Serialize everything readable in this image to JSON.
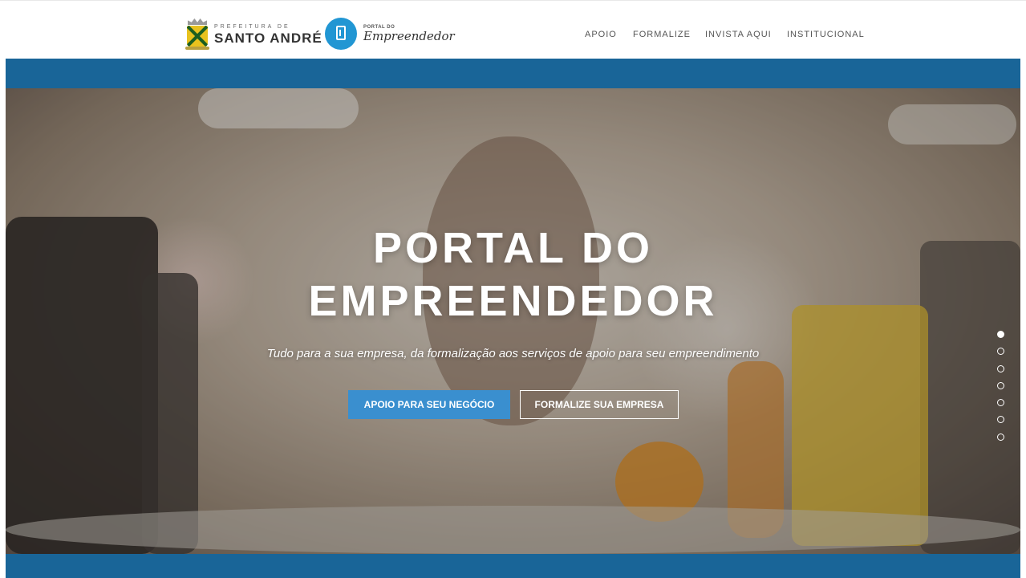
{
  "header": {
    "logo_prefeitura": {
      "small": "PREFEITURA DE",
      "big": "SANTO ANDRÉ"
    },
    "logo_portal": {
      "small": "PORTAL DO",
      "big": "Empreendedor"
    },
    "nav": [
      {
        "label": "APOIO"
      },
      {
        "label": "FORMALIZE"
      },
      {
        "label": "INVISTA AQUI"
      },
      {
        "label": "INSTITUCIONAL"
      }
    ]
  },
  "hero": {
    "title_line1": "PORTAL DO",
    "title_line2": "EMPREENDEDOR",
    "subtitle": "Tudo para a sua empresa, da formalização aos serviços de apoio para seu empreendimento",
    "primary_button": "APOIO PARA SEU NEGÓCIO",
    "secondary_button": "FORMALIZE SUA EMPRESA",
    "slider": {
      "slide_count": 7,
      "active_index": 0
    }
  },
  "colors": {
    "band": "#196598",
    "primary_button": "#3a8fcf",
    "logo_circle": "#2196d3",
    "nav_text": "#555555"
  },
  "icons": [
    "santo-andre-crest-icon",
    "building-icon"
  ]
}
